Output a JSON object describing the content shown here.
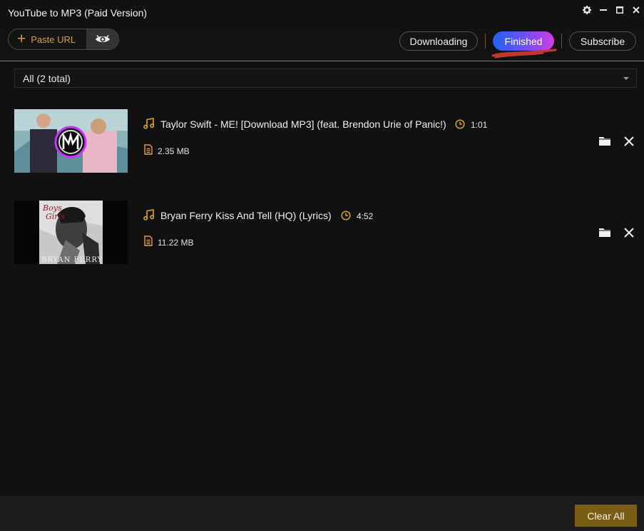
{
  "window": {
    "title": "YouTube to MP3 (Paid Version)"
  },
  "toolbar": {
    "paste_url_label": "Paste URL",
    "tabs": {
      "downloading": "Downloading",
      "finished": "Finished",
      "subscribe": "Subscribe"
    },
    "active_tab": "Finished"
  },
  "filter": {
    "selected": "All (2 total)"
  },
  "items": [
    {
      "title": "Taylor Swift - ME! [Download MP3] (feat. Brendon Urie of Panic!)",
      "duration": "1:01",
      "size": "2.35 MB",
      "thumbnail_caption": ""
    },
    {
      "title": "Bryan Ferry Kiss And Tell (HQ) (Lyrics)",
      "duration": "4:52",
      "size": "11.22 MB",
      "thumbnail_caption": "BRYAN FERRY"
    }
  ],
  "footer": {
    "clear_all_label": "Clear All"
  },
  "colors": {
    "accent": "#d8a32c",
    "finished_gradient_start": "#1f63f2",
    "finished_gradient_end": "#d43ce0",
    "clear_button": "#7a5c14"
  }
}
